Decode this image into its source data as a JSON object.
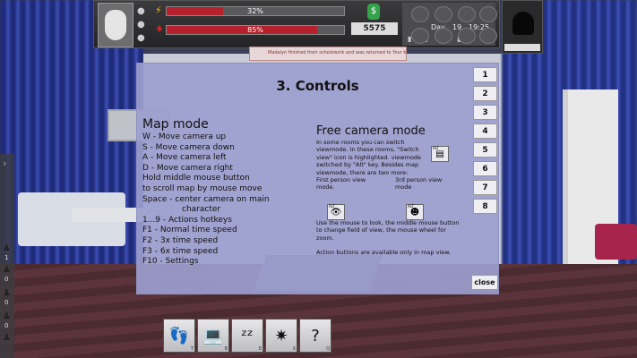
{
  "hud": {
    "bar1_label": "32%",
    "bar1_value": 32,
    "bar2_label": "85%",
    "bar2_value": 85,
    "money": "5575",
    "day_label": "Day",
    "day_value": "19",
    "time": "19:25",
    "notice": "Madalyn finished their schoolwork and was returned to Your bed"
  },
  "sidebar": {
    "arrow": "›",
    "counts": [
      "1",
      "0",
      "0",
      "0"
    ]
  },
  "actions": [
    {
      "icon": "👣",
      "key": "T"
    },
    {
      "icon": "💻",
      "key": "B"
    },
    {
      "icon": "ᶻᶻ",
      "key": "E"
    },
    {
      "icon": "✷",
      "key": "X"
    },
    {
      "icon": "?",
      "key": "Q"
    }
  ],
  "dialog": {
    "title": "3. Controls",
    "map_mode": {
      "heading": "Map mode",
      "lines": [
        "W - Move camera up",
        "S - Move camera down",
        "A - Move camera left",
        "D - Move camera right",
        "Hold middle mouse button",
        "to scroll map by mouse move",
        "Space - center camera on main",
        "character",
        "1...9 - Actions hotkeys",
        "F1 - Normal time speed",
        "F2 - 3x time speed",
        "F3 - 6x time speed",
        "F10 - Settings"
      ]
    },
    "free_camera": {
      "heading": "Free camera mode",
      "para1": "In some rooms you can switch viewmode. In these rooms, \"Switch view\" icon is highlighted. viewmode switched by \"Alt\" key. Besides map viewmode, there are two more:",
      "first_person": "First person view mode.",
      "third_person": "3rd person view mode",
      "para2": "Use the mouse to look, the middle mouse button to change field of view, the mouse wheel for zoom.",
      "para3": "Action buttons are available only in map view.",
      "alt_label": "ALT"
    },
    "tabs": [
      "1",
      "2",
      "3",
      "4",
      "5",
      "6",
      "7",
      "8"
    ],
    "close_label": "close"
  }
}
